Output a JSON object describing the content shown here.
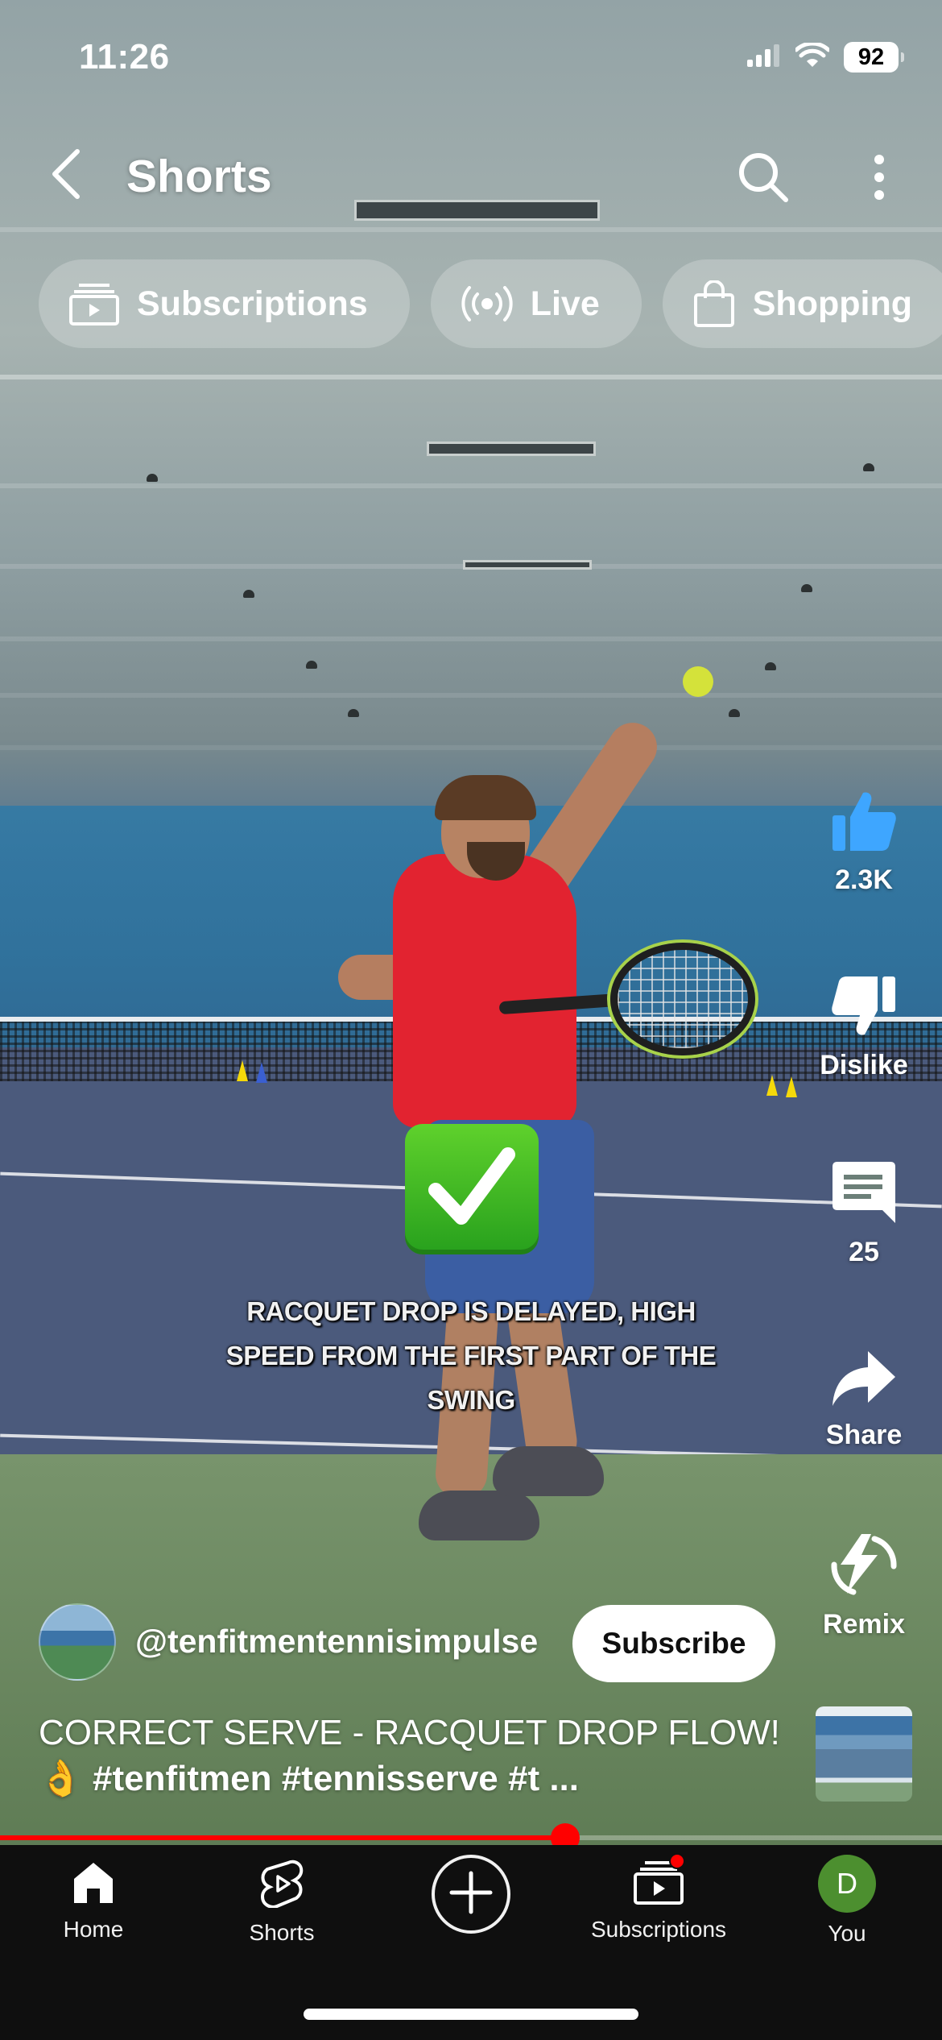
{
  "status_bar": {
    "time": "11:26",
    "battery": "92"
  },
  "header": {
    "title": "Shorts"
  },
  "chips": [
    {
      "label": "Subscriptions",
      "icon": "subscriptions-icon"
    },
    {
      "label": "Live",
      "icon": "live-icon"
    },
    {
      "label": "Shopping",
      "icon": "shopping-bag-icon"
    }
  ],
  "video": {
    "caption": "RACQUET DROP IS DELAYED, HIGH SPEED FROM THE FIRST PART OF THE SWING",
    "overlay_emoji": "check-mark-button-icon",
    "progress": 0.6
  },
  "actions": {
    "like": {
      "label": "2.3K",
      "icon": "thumbs-up-icon",
      "active_color": "#3ea6ff"
    },
    "dislike": {
      "label": "Dislike",
      "icon": "thumbs-down-icon"
    },
    "comments": {
      "label": "25",
      "icon": "comment-icon"
    },
    "share": {
      "label": "Share",
      "icon": "share-icon"
    },
    "remix": {
      "label": "Remix",
      "icon": "remix-icon"
    }
  },
  "channel": {
    "handle": "@tenfitmentennisimpulse",
    "subscribe_label": "Subscribe"
  },
  "description": {
    "text": "CORRECT SERVE - RACQUET DROP FLOW! 👌 ",
    "tags": "#tenfitmen #tennisserve #t ..."
  },
  "bottom_nav": {
    "items": [
      {
        "label": "Home",
        "icon": "home-icon"
      },
      {
        "label": "Shorts",
        "icon": "shorts-icon"
      },
      {
        "label": "",
        "icon": "create-plus-icon"
      },
      {
        "label": "Subscriptions",
        "icon": "subscriptions-icon"
      },
      {
        "label": "You",
        "icon": "avatar"
      }
    ],
    "you_initial": "D"
  },
  "colors": {
    "progress": "#ff0000",
    "avatar_bg": "#4c8f2f",
    "like": "#3ea6ff"
  }
}
